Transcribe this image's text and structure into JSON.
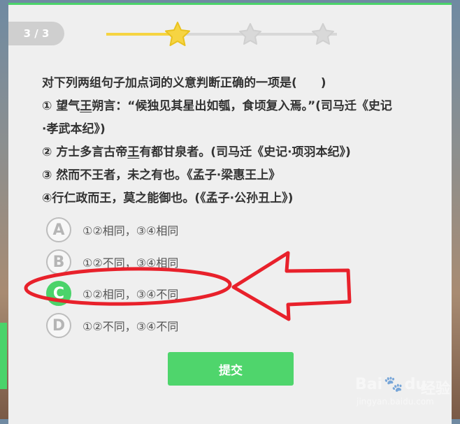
{
  "header": {
    "counter": "3 / 3",
    "progress": {
      "steps_total": 3,
      "current_step": 1,
      "fill_fraction": 0.31
    }
  },
  "question": {
    "title": "对下列两组句子加点词的义意判断正确的一项是(　　)",
    "line1a": "① 望气",
    "line1u": "王",
    "line1b": "朔言：“候独见其星出如瓠，食顷复入焉。”(司马迁《史记",
    "line1c": "·孝武本纪》)",
    "line2a": "② 方士多言古帝",
    "line2u": "王",
    "line2b": "有都甘泉者。(司马迁《史记·项羽本纪》)",
    "line3": "③ 然而不王者，未之有也。《孟子·梁惠王上》",
    "line4": "④行仁政而王，莫之能御也。(《孟子·公孙丑上》)"
  },
  "options": [
    {
      "letter": "A",
      "text": "①②相同，③④相同",
      "selected": false
    },
    {
      "letter": "B",
      "text": "①②不同，③④相同",
      "selected": false
    },
    {
      "letter": "C",
      "text": "①②相同，③④不同",
      "selected": true
    },
    {
      "letter": "D",
      "text": "①②不同，③④不同",
      "selected": false
    }
  ],
  "submit_label": "提交",
  "watermark": {
    "brand": "Bai",
    "brand_suffix": "du",
    "cn": "经验",
    "url": "jingyan.baidu.com"
  },
  "colors": {
    "accent": "#4bd36a",
    "star_active": "#f6d442",
    "annotation": "#e8212b"
  }
}
